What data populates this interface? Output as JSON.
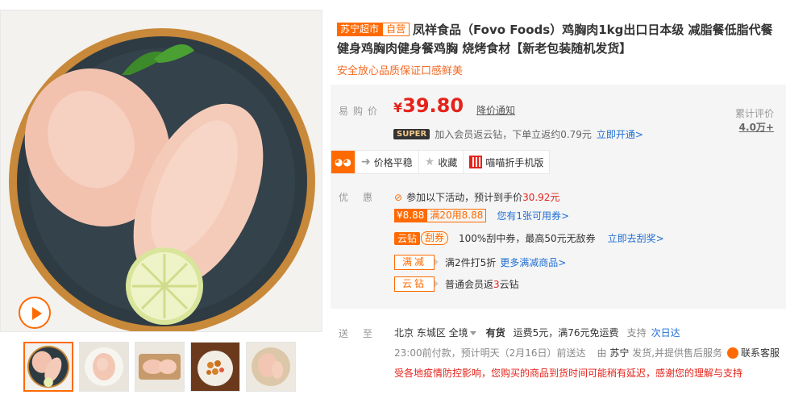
{
  "product": {
    "badge_suning": "苏宁超市",
    "badge_self": "自营",
    "title": "凤祥食品（Fovo Foods）鸡胸肉1kg出口日本级 减脂餐低脂代餐健身鸡胸肉健身餐鸡胸 烧烤食材【新老包装随机发货】",
    "subtitle": "安全放心品质保证口感鲜美"
  },
  "price": {
    "label": "易购价",
    "currency": "¥",
    "value": "39.80",
    "notify": "降价通知",
    "review_label": "累计评价",
    "review_count": "4.0万+",
    "super_badge": "SUPER",
    "super_text": "加入会员返云钻，下单立返约0.79元",
    "super_link": "立即开通>"
  },
  "actions": {
    "price_stable": "价格平稳",
    "favorite": "收藏",
    "mobile": "喵喵折手机版"
  },
  "promos": {
    "label": "优惠",
    "activity_text": "参加以下活动，预计到手价",
    "activity_price": "30.92元",
    "coupon_tag": "¥8.88",
    "coupon_cond": "满20用8.88",
    "coupon_link": "您有1张可用券>",
    "yunzuan_tag": "云钻",
    "gua_tag": "刮券",
    "gua_text": "100%刮中券，最高50元无敌券",
    "gua_link": "立即去刮奖>",
    "manjian_tag": "满减",
    "manjian_text": "满2件打5折",
    "manjian_link": "更多满减商品>",
    "yunzuan2_tag": "云钻",
    "yunzuan2_text_a": "普通会员返",
    "yunzuan2_num": "3",
    "yunzuan2_text_b": "云钻"
  },
  "delivery": {
    "label": "送至",
    "location": "北京 东城区 全境",
    "stock": "有货",
    "fee": "运费5元，满76元免运费",
    "support": "支持",
    "support_link": "次日达",
    "eta": "23:00前付款，预计明天（2月16日）前送达",
    "seller_a": "由",
    "seller_name": "苏宁",
    "seller_b": "发货,并提供售后服务",
    "contact": "联系客服",
    "notice": "受各地疫情防控影响，您购买的商品到货时间可能稍有延迟，感谢您的理解与支持"
  },
  "colors": {
    "brand_orange": "#ff6a00",
    "price_red": "#e5231a",
    "link_blue": "#1f6ed4"
  }
}
